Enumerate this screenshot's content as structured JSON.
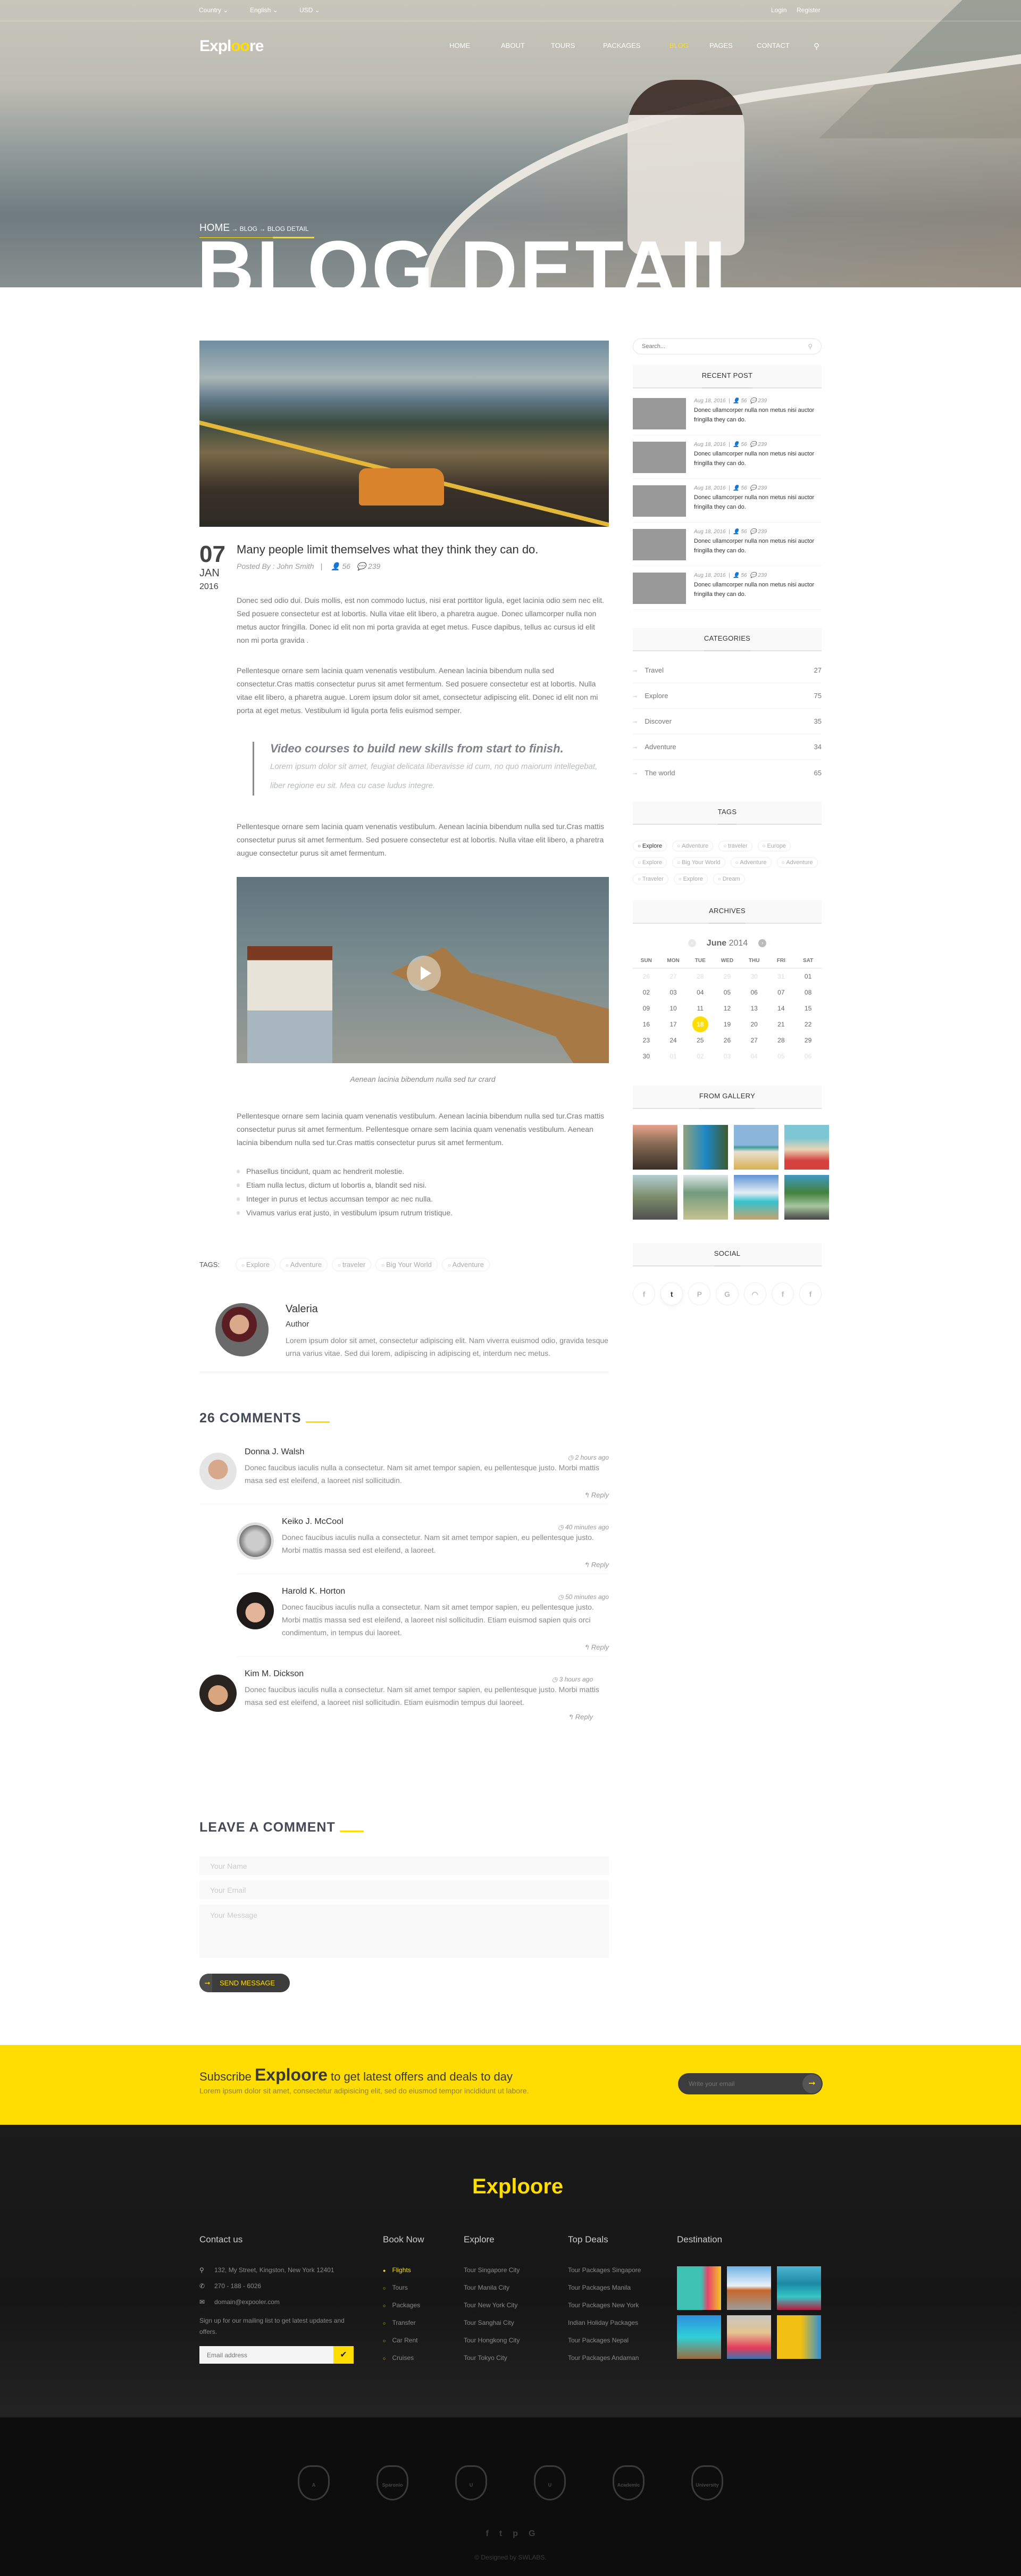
{
  "topbar": {
    "country": "Country ⌄",
    "language": "English ⌄",
    "currency": "USD ⌄",
    "login": "Login",
    "register": "Register"
  },
  "brand": {
    "logo_a": "Expl",
    "logo_b": "oo",
    "logo_c": "re",
    "accent": "#FFDD00"
  },
  "nav": [
    {
      "label": "HOME"
    },
    {
      "label": "ABOUT"
    },
    {
      "label": "TOURS"
    },
    {
      "label": "PACKAGES"
    },
    {
      "label": "BLOG"
    },
    {
      "label": "PAGES"
    },
    {
      "label": "CONTACT"
    }
  ],
  "hero": {
    "crumb_home": "HOME",
    "crumb_sep": " → ",
    "crumb_blog": "BLOG",
    "crumb_current": "BLOG DETAIL",
    "title": "BLOG DETAIL"
  },
  "post": {
    "day": "07",
    "month": "JAN",
    "year": "2016",
    "title": "Many people limit themselves what they think they can do.",
    "posted_by": "Posted By : John Smith",
    "sep": "|",
    "views": "56",
    "comments": "239",
    "p1": "Donec sed odio dui. Duis mollis, est non commodo luctus, nisi erat porttitor ligula, eget lacinia odio sem nec elit. Sed posuere consectetur est at lobortis. Nulla vitae elit libero, a pharetra augue. Donec ullamcorper nulla non metus auctor fringilla. Donec id elit non mi porta gravida at eget metus. Fusce dapibus, tellus ac cursus id elit non mi porta gravida .",
    "p2": "Pellentesque ornare sem lacinia quam venenatis vestibulum. Aenean lacinia bibendum nulla sed consectetur.Cras mattis consectetur purus sit amet fermentum. Sed posuere consectetur est at lobortis. Nulla vitae elit libero, a pharetra augue. Lorem ipsum dolor sit amet, consectetur adipiscing elit. Donec id elit non mi porta at eget metus. Vestibulum id ligula porta felis euismod semper.",
    "quote_title": "Video courses to build new skills from start to finish.",
    "quote_text": "Lorem ipsum dolor sit amet, feugiat delicata liberavisse id cum, no quo maiorum intellegebat, liber regione eu sit. Mea cu case ludus integre.",
    "p3": "Pellentesque ornare sem lacinia quam venenatis vestibulum. Aenean lacinia bibendum nulla sed tur.Cras mattis consectetur purus sit amet fermentum. Sed posuere consectetur est at lobortis. Nulla vitae elit libero, a pharetra augue consectetur purus sit amet fermentum.",
    "caption": "Aenean lacinia bibendum nulla sed tur crard",
    "p4": "Pellentesque ornare sem lacinia quam venenatis vestibulum. Aenean lacinia bibendum nulla sed tur.Cras mattis consectetur purus sit amet fermentum. Pellentesque ornare sem lacinia quam venenatis vestibulum. Aenean lacinia bibendum nulla sed tur.Cras mattis consectetur purus sit amet fermentum.",
    "list": [
      "Phasellus tincidunt, quam ac hendrerit molestie.",
      "Etiam nulla lectus, dictum ut lobortis a, blandit sed nisi.",
      "Integer in purus et lectus accumsan tempor ac nec nulla.",
      "Vivamus varius erat justo, in vestibulum ipsum rutrum tristique."
    ],
    "tags_label": "TAGS:",
    "tags": [
      "Explore",
      "Adventure",
      "traveler",
      "Big Your World",
      "Adventure"
    ]
  },
  "author": {
    "name": "Valeria",
    "role": "Author",
    "bio": "Lorem ipsum dolor sit amet, consectetur adipiscing elit. Nam viverra euismod odio, gravida tesque urna varius vitae. Sed dui lorem, adipiscing in adipiscing et, interdum nec metus."
  },
  "comments": {
    "heading": "26 COMMENTS",
    "reply": "Reply",
    "items": [
      {
        "name": "Donna J. Walsh",
        "time": "2 hours ago",
        "text": "Donec faucibus iaculis nulla a consectetur. Nam sit amet tempor sapien, eu pellentesque justo. Morbi mattis masa sed est eleifend, a laoreet nisl sollicitudin."
      },
      {
        "name": "Keiko J. McCool",
        "time": "40 minutes ago",
        "text": "Donec faucibus iaculis nulla a consectetur. Nam sit amet tempor sapien, eu pellentesque justo. Morbi mattis massa sed est eleifend, a laoreet."
      },
      {
        "name": "Harold K. Horton",
        "time": "50 minutes ago",
        "text": "Donec faucibus iaculis nulla a consectetur. Nam sit amet tempor sapien, eu pellentesque justo. Morbi mattis massa sed est eleifend, a laoreet nisl sollicitudin. Etiam euismod sapien quis orci condimentum, in tempus dui laoreet."
      },
      {
        "name": "Kim M. Dickson",
        "time": "3 hours ago",
        "text": "Donec faucibus iaculis nulla a consectetur. Nam sit amet tempor sapien, eu pellentesque justo. Morbi mattis masa sed est eleifend, a laoreet nisl sollicitudin. Etiam euismodin tempus dui laoreet."
      }
    ]
  },
  "form": {
    "heading": "LEAVE A COMMENT",
    "name_ph": "Your Name",
    "email_ph": "Your Email",
    "message_ph": "Your Message",
    "send": "SEND MESSAGE"
  },
  "sidebar": {
    "search_ph": "Search...",
    "recent_title": "RECENT POST",
    "recent_posts": [
      {
        "date": "Aug 18, 2016",
        "views": "56",
        "comments": "239",
        "title": "Donec ullamcorper nulla non metus nisi auctor fringilla they can do."
      },
      {
        "date": "Aug 18, 2016",
        "views": "56",
        "comments": "239",
        "title": "Donec ullamcorper nulla non metus nisi auctor fringilla they can do."
      },
      {
        "date": "Aug 18, 2016",
        "views": "56",
        "comments": "239",
        "title": "Donec ullamcorper nulla non metus nisi auctor fringilla they can do."
      },
      {
        "date": "Aug 18, 2016",
        "views": "56",
        "comments": "239",
        "title": "Donec ullamcorper nulla non metus nisi auctor fringilla they can do."
      },
      {
        "date": "Aug 18, 2016",
        "views": "56",
        "comments": "239",
        "title": "Donec ullamcorper nulla non metus nisi auctor fringilla they can do."
      }
    ],
    "categories_title": "CATEGORIES",
    "categories": [
      {
        "name": "Travel",
        "count": "27"
      },
      {
        "name": "Explore",
        "count": "75"
      },
      {
        "name": "Discover",
        "count": "35"
      },
      {
        "name": "Adventure",
        "count": "34"
      },
      {
        "name": "The world",
        "count": "65"
      }
    ],
    "tags_title": "TAGS",
    "tags": [
      "Explore",
      "Adventure",
      "traveler",
      "Europe",
      "Explore",
      "Big Your World",
      "Adventure",
      "Adventure",
      "Traveler",
      "Explore",
      "Dream"
    ],
    "archives_title": "ARCHIVES",
    "calendar": {
      "month": "June",
      "year": "2014",
      "weekdays": [
        "SUN",
        "MON",
        "TUE",
        "WED",
        "THU",
        "FRI",
        "SAT"
      ],
      "selected": "18",
      "weeks": [
        [
          {
            "d": "26",
            "m": true
          },
          {
            "d": "27",
            "m": true
          },
          {
            "d": "28",
            "m": true
          },
          {
            "d": "29",
            "m": true
          },
          {
            "d": "30",
            "m": true
          },
          {
            "d": "31",
            "m": true
          },
          {
            "d": "01"
          }
        ],
        [
          {
            "d": "02"
          },
          {
            "d": "03"
          },
          {
            "d": "04"
          },
          {
            "d": "05"
          },
          {
            "d": "06"
          },
          {
            "d": "07"
          },
          {
            "d": "08"
          }
        ],
        [
          {
            "d": "09"
          },
          {
            "d": "10"
          },
          {
            "d": "11"
          },
          {
            "d": "12"
          },
          {
            "d": "13"
          },
          {
            "d": "14"
          },
          {
            "d": "15"
          }
        ],
        [
          {
            "d": "16"
          },
          {
            "d": "17"
          },
          {
            "d": "18"
          },
          {
            "d": "19"
          },
          {
            "d": "20"
          },
          {
            "d": "21"
          },
          {
            "d": "22"
          }
        ],
        [
          {
            "d": "23"
          },
          {
            "d": "24"
          },
          {
            "d": "25"
          },
          {
            "d": "26"
          },
          {
            "d": "27"
          },
          {
            "d": "28"
          },
          {
            "d": "29"
          }
        ],
        [
          {
            "d": "30"
          },
          {
            "d": "01",
            "m": true
          },
          {
            "d": "02",
            "m": true
          },
          {
            "d": "03",
            "m": true
          },
          {
            "d": "04",
            "m": true
          },
          {
            "d": "05",
            "m": true
          },
          {
            "d": "06",
            "m": true
          }
        ]
      ]
    },
    "gallery_title": "FROM GALLERY",
    "social_title": "SOCIAL",
    "social": [
      {
        "icon": "facebook-icon",
        "glyph": "f"
      },
      {
        "icon": "twitter-icon",
        "glyph": "t"
      },
      {
        "icon": "pinterest-icon",
        "glyph": "P"
      },
      {
        "icon": "google-icon",
        "glyph": "G"
      },
      {
        "icon": "rss-icon",
        "glyph": "◠"
      },
      {
        "icon": "facebook-icon",
        "glyph": "f"
      },
      {
        "icon": "facebook-icon",
        "glyph": "f"
      }
    ]
  },
  "subscribe": {
    "pre": "Subscribe ",
    "brand": "Exploore",
    "post": " to get latest offers and deals to day",
    "text": "Lorem ipsum dolor sit amet, consectetur adipisicing elit, sed do eiusmod tempor incididunt ut labore.",
    "placeholder": "Write your email"
  },
  "footer": {
    "logo": "Exploore",
    "contact_title": "Contact us",
    "address": "132, My Street, Kingston, New York 12401",
    "phone": "270 - 188 - 6026",
    "email": "domain@expooler.com",
    "signup": "Sign up for our mailing list to get latest updates and offers.",
    "email_ph": "Email address",
    "book_title": "Book Now",
    "book": [
      "Flights",
      "Tours",
      "Packages",
      "Transfer",
      "Car Rent",
      "Cruises"
    ],
    "explore_title": "Explore",
    "explore": [
      "Tour  Singapore City",
      "Tour  Manila City",
      "Tour  New York City",
      "Tour  Sanghai City",
      "Tour  Hongkong City",
      "Tour  Tokyo City"
    ],
    "deals_title": "Top Deals",
    "deals": [
      "Tour Packages Singapore",
      "Tour Packages Manila",
      "Tour Packages New York",
      "Indian Holiday Packages",
      "Tour Packages Nepal",
      "Tour Packages Andaman"
    ],
    "dest_title": "Destination",
    "badges": [
      "A",
      "Sparonio",
      "U",
      "U",
      "Academic",
      "University"
    ],
    "social": [
      "f",
      "t",
      "p",
      "G"
    ],
    "copyright": "© Designed by SWLABS."
  }
}
